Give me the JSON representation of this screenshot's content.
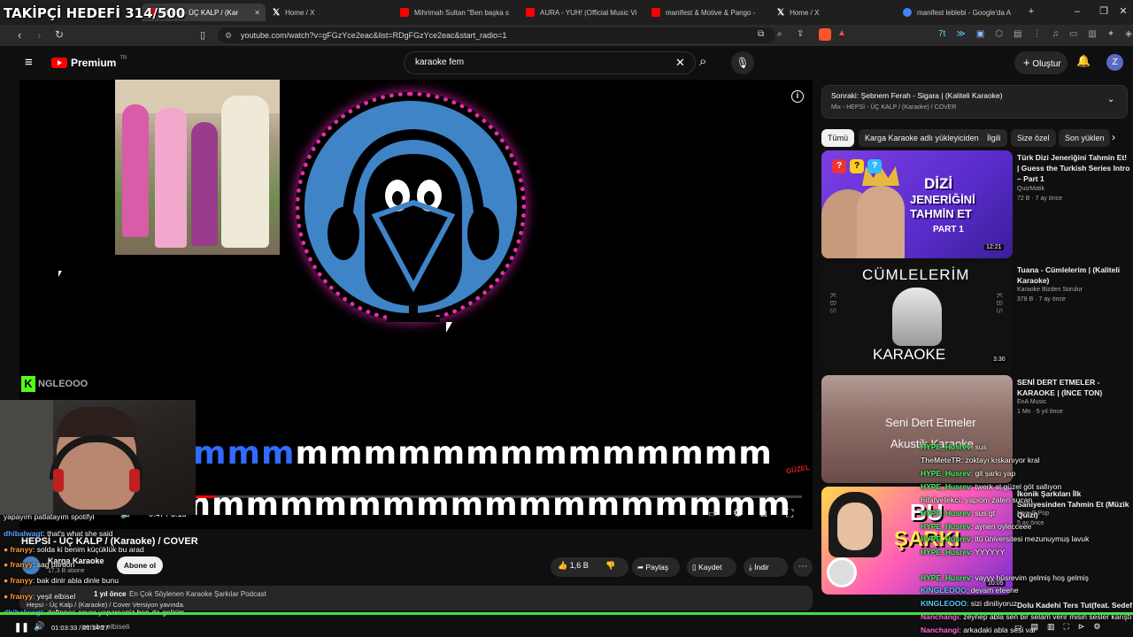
{
  "overlay": {
    "goal_text": "TAKİPÇİ HEDEFİ 314/500",
    "brand": "NGLEOOO"
  },
  "browser": {
    "tabs": [
      {
        "label": "HEPSİ - ÜÇ KALP / (Kar",
        "color": "#ff0000"
      },
      {
        "label": "Home / X",
        "color": "#ffffff"
      },
      {
        "label": "Mihrimah Sultan \"Ben başka s",
        "color": "#ff0000"
      },
      {
        "label": "AURA - YUH! (Official Music Vi",
        "color": "#ff0000"
      },
      {
        "label": "manifest & Motive & Pango -",
        "color": "#ff0000"
      },
      {
        "label": "Home / X",
        "color": "#ffffff"
      },
      {
        "label": "manifest leblebi - Google'da A",
        "color": "#4285f4"
      }
    ],
    "url": "youtube.com/watch?v=gFGzYce2eac&list=RDgFGzYce2eac&start_radio=1"
  },
  "youtube": {
    "logo": "Premium",
    "logo_region": "TR",
    "search_value": "karaoke fem",
    "create_label": "Oluştur",
    "avatar_letter": "Z"
  },
  "player": {
    "lyric_line1_sung": "mmm",
    "lyric_line1_rest": "mmmmmmmmmmmmmm",
    "lyric_line2": "mmmmmmmmmmmmmmmmmmm",
    "time": "0:47 / 3:15",
    "corner_label": "GÜZEL"
  },
  "video": {
    "title": "HEPSİ - ÜÇ KALP / (Karaoke) / COVER",
    "channel": "Karga Karaoke",
    "subscribers": "17,3 B abone",
    "subscribe_label": "Abone ol",
    "likes": "1,6 B",
    "share_label": "Paylaş",
    "save_label": "Kaydet",
    "download_label": "İndir",
    "desc_time": "1 yıl önce",
    "desc_tag": "En Çok Söylenen Karaoke Şarkılar Podcast",
    "desc_line2": "Hepsi - Üç Kalp / (Karaoke) / Cover Versiyon yavında."
  },
  "queue": {
    "next": "Sonraki: Şebnem Ferah - Sigara | (Kaliteli Karaoke)",
    "mix": "Mix - HEPSİ - ÜÇ KALP / (Karaoke) / COVER"
  },
  "chips": [
    "Tümü",
    "Karga Karaoke adlı yükleyiciden",
    "İlgili",
    "Size özel",
    "Son yüklen"
  ],
  "recs": [
    {
      "title": "Türk Dizi Jeneriğini Tahmin Et! | Guess the Turkish Series Intro – Part 1",
      "channel": "QuizMatik",
      "meta": "72 B  ·  7 ay önce",
      "duration": "12:21",
      "thumb_l1": "DİZİ",
      "thumb_l2": "JENERİĞİNİ",
      "thumb_l3": "TAHMİN ET",
      "thumb_l4": "PART 1"
    },
    {
      "title": "Tuana - Cümlelerim | (Kaliteli Karaoke)",
      "channel": "Karaoke Bizden Sorulur",
      "meta": "378 B  ·  7 ay önce",
      "duration": "3:30",
      "thumb_l1": "CÜMLELERİM",
      "thumb_l2": "KARAOKE",
      "thumb_side": "K B S"
    },
    {
      "title": "SENİ DERT ETMELER - KARAOKE | (İNCE TON)",
      "channel": "EnA Music",
      "meta": "1 Mn  ·  5 yıl önce",
      "thumb_l1": "Seni Dert Etmeler",
      "thumb_l2": "Akustik Karaoke"
    },
    {
      "title": "İkonik Şarkıları İlk Saniyesinden Tahmin Et (Müzik Quizi)",
      "channel": "New-G Pop",
      "meta": "5 ay önce",
      "duration": "10:05",
      "thumb_l1": "BU",
      "thumb_l2": "ŞARKI"
    },
    {
      "title": "Dolu Kadehi Ters Tut(feat. Sedef",
      "channel": "",
      "meta": ""
    }
  ],
  "chat": [
    {
      "user": "",
      "text": "yapayım patlatayım spotifyi",
      "color": "u-meta"
    },
    {
      "user": "dhibalwagt",
      "text": "that's what she said",
      "color": "u-blue"
    },
    {
      "user": "franyy",
      "text": "solda ki benim küçüklük bu arad",
      "color": "u-orange"
    },
    {
      "user": "franyy",
      "text": "sag pardon",
      "color": "u-orange"
    },
    {
      "user": "franyy",
      "text": "bak dinlr abla dinle bunu",
      "color": "u-orange"
    },
    {
      "user": "franyy",
      "text": "yeşil elbisel",
      "color": "u-orange"
    },
    {
      "user": "dhibalwagt",
      "text": "deftones cover yaparsaniz ben de gelirim",
      "color": "u-blue"
    },
    {
      "user": "",
      "text": "pembe elbiseli",
      "color": "u-meta"
    }
  ],
  "chat_right": [
    {
      "user": "HYPE_Husrev",
      "text": "sus"
    },
    {
      "user": "TheMeteTR",
      "text": "zoktayı kıskanıyor kral"
    },
    {
      "user": "HYPE_Husrev",
      "text": "git şarkı yap"
    },
    {
      "user": "HYPE_Husrev",
      "text": "twerk at güzel göt sallıyon"
    },
    {
      "user": "hilalvelekci",
      "text": "yapıom zaten sucan"
    },
    {
      "user": "HYPE_Husrev",
      "text": "sus gt"
    },
    {
      "user": "HYPE_Husrev",
      "text": "aynen oylecceee"
    },
    {
      "user": "HYPE_Husrev",
      "text": "itü üniversitesi mezunuymuş lavuk"
    },
    {
      "user": "HYPE_Husrev",
      "text": "YYYYYY"
    },
    {
      "user": "HYPE_Husrev",
      "text": "vayyy hüsrevim gelmiş hoş gelmiş"
    },
    {
      "user": "KINGLEOOO",
      "text": "devam eteene"
    },
    {
      "user": "KINGLEOOO",
      "text": "sizi diniliyoruz"
    },
    {
      "user": "Nanchangi",
      "text": "zeynep abla sen bir selam verir misin sesler karıştı h"
    },
    {
      "user": "Nanchangi",
      "text": "arkadaki abla sesi var"
    }
  ],
  "stream": {
    "time": "01:03:33 / 01:14:27"
  },
  "colors": {
    "accent": "#ff0000",
    "progress": "#3fe03f"
  }
}
